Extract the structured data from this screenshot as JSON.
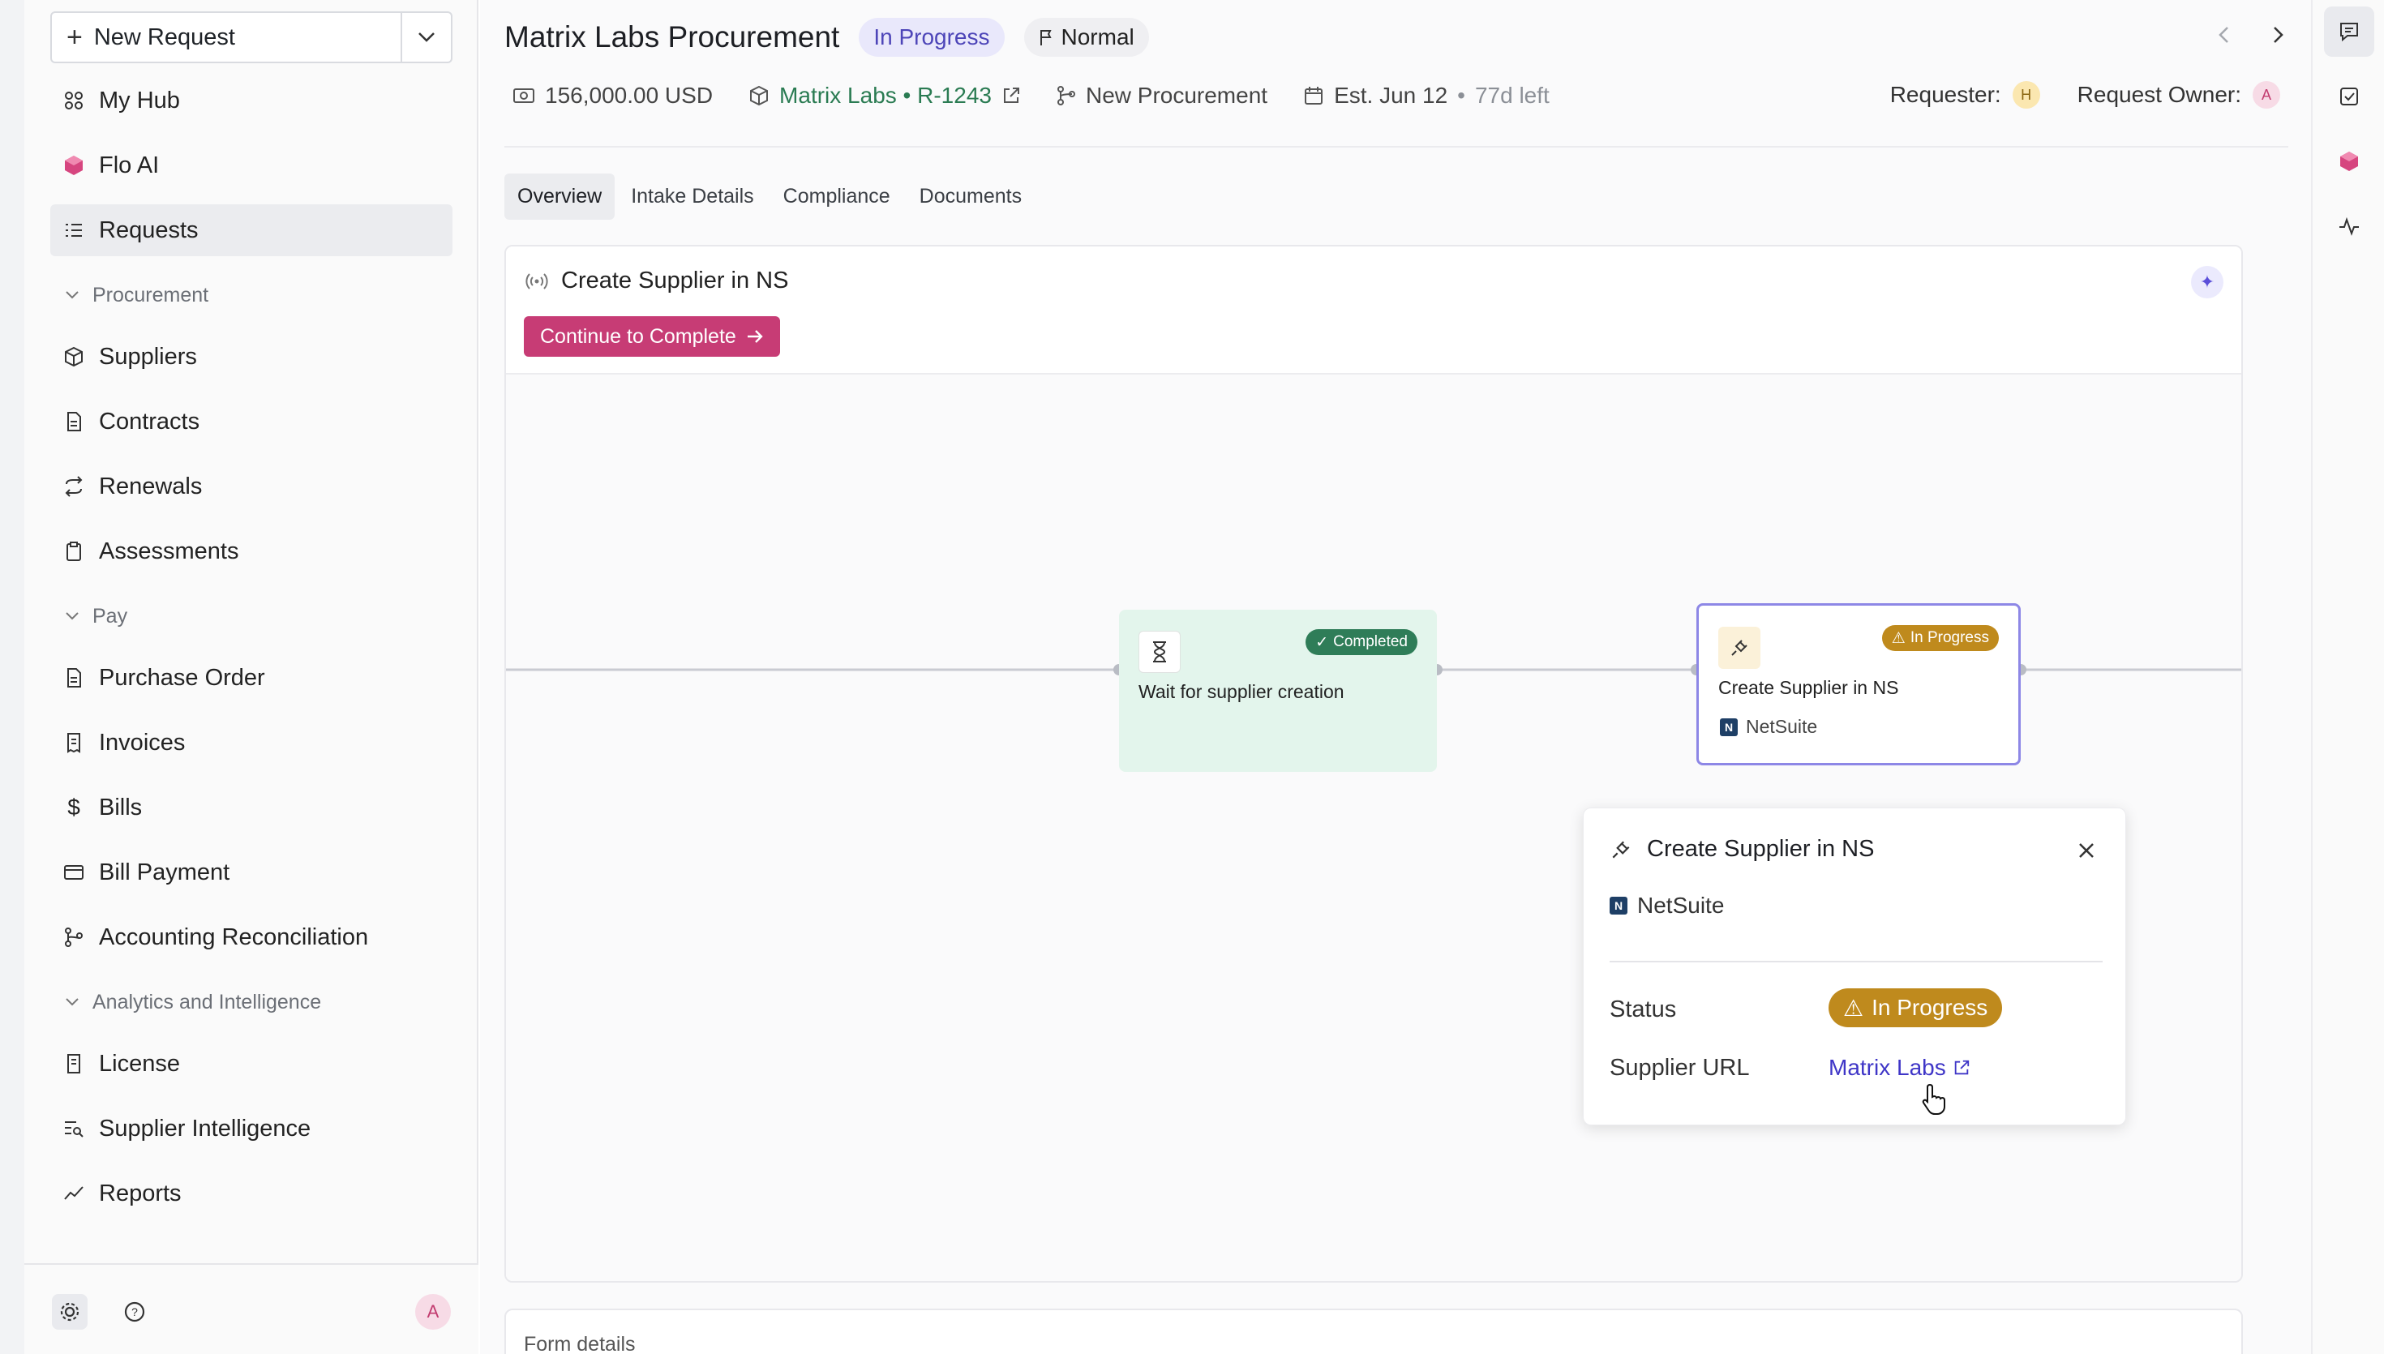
{
  "sidebar": {
    "new_request_label": "New Request",
    "items_top": [
      {
        "label": "My Hub",
        "icon": "hub-icon"
      },
      {
        "label": "Flo AI",
        "icon": "flo-ai-icon"
      },
      {
        "label": "Requests",
        "icon": "list-icon"
      }
    ],
    "sections": [
      {
        "label": "Procurement",
        "items": [
          {
            "label": "Suppliers"
          },
          {
            "label": "Contracts"
          },
          {
            "label": "Renewals"
          },
          {
            "label": "Assessments"
          }
        ]
      },
      {
        "label": "Pay",
        "items": [
          {
            "label": "Purchase Order"
          },
          {
            "label": "Invoices"
          },
          {
            "label": "Bills"
          },
          {
            "label": "Bill Payment"
          },
          {
            "label": "Accounting Reconciliation"
          }
        ]
      },
      {
        "label": "Analytics and Intelligence",
        "items": [
          {
            "label": "License"
          },
          {
            "label": "Supplier Intelligence"
          },
          {
            "label": "Reports"
          }
        ]
      }
    ],
    "avatar_initial": "A"
  },
  "header": {
    "title": "Matrix Labs Procurement",
    "status": "In Progress",
    "priority": "Normal",
    "amount": "156,000.00 USD",
    "supplier_link": "Matrix Labs • R-1243",
    "type": "New Procurement",
    "estimate": "Est. Jun 12",
    "separator": "•",
    "time_left": "77d left",
    "requester_label": "Requester:",
    "requester_initial": "H",
    "owner_label": "Request Owner:",
    "owner_initial": "A"
  },
  "tabs": [
    "Overview",
    "Intake Details",
    "Compliance",
    "Documents"
  ],
  "workflow_card": {
    "title": "Create Supplier in NS",
    "cta": "Continue to Complete",
    "nodes": {
      "wait": {
        "label": "Wait for supplier creation",
        "status": "Completed"
      },
      "create": {
        "label": "Create Supplier in NS",
        "status": "In Progress",
        "integration": "NetSuite"
      }
    }
  },
  "popover": {
    "title": "Create Supplier in NS",
    "integration": "NetSuite",
    "status_label": "Status",
    "status_value": "In Progress",
    "url_label": "Supplier URL",
    "url_value": "Matrix Labs"
  },
  "form_details_label": "Form details",
  "colors": {
    "accent": "#c73c75",
    "status_progress": "#bf8a1d",
    "status_complete": "#2f7d58",
    "link": "#3f36c7"
  }
}
